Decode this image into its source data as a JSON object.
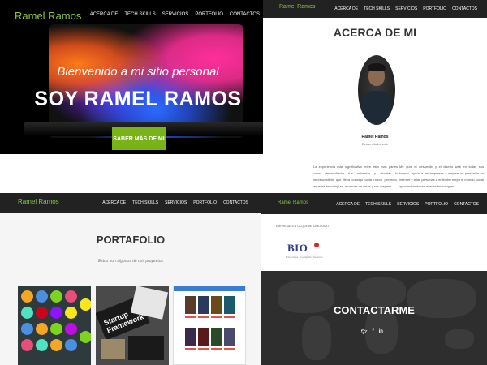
{
  "brand": "Ramel Ramos",
  "nav": {
    "items": [
      "ACERCA DE",
      "TECH SKILLS",
      "SERVICIOS",
      "PORTFOLIO",
      "CONTACTOS"
    ]
  },
  "hero": {
    "subtitle": "Bienvenido a mi sitio personal",
    "title": "SOY RAMEL RAMOS",
    "button": "SABER MÁS DE MI"
  },
  "about": {
    "title": "ACERCA DE MI",
    "name": "Ramel Ramos",
    "role": "Desarrollador web",
    "col1": "La experiencia más significativa entre esto mas partes como desarrollador fue enfrentar y afrontar lo imprescindible que lleva consigo cada nuevo proyecto, aquellas tecnologías, alcances de estas y sus mejores",
    "col2": "Me guta el desarrollo y el diseño web en todas sus formas, ayudo a las empresas a mejorar su presencia en internet y a las personas a entender mejor el mundo social aprovechando las nuevas tecnologías"
  },
  "portfolio": {
    "title": "PORTAFOLIO",
    "subtitle": "Estos son algunos de mis proyectos",
    "startup_text": "Startup Framework"
  },
  "contact": {
    "worked_label": "EMPRESAS EN LA QUE HE LABORADO",
    "company_logo": "BIO",
    "company_tagline": "Biotecnologia · Investigación · Desarrollo",
    "title": "CONTACTARME",
    "social": [
      "twitter-icon",
      "facebook-icon",
      "linkedin-icon"
    ]
  },
  "colors": {
    "accent": "#7ab317",
    "brand_green": "#8bc34a",
    "navbar": "#222222",
    "bio_blue": "#2a3a8c",
    "bio_red": "#d6252c"
  }
}
